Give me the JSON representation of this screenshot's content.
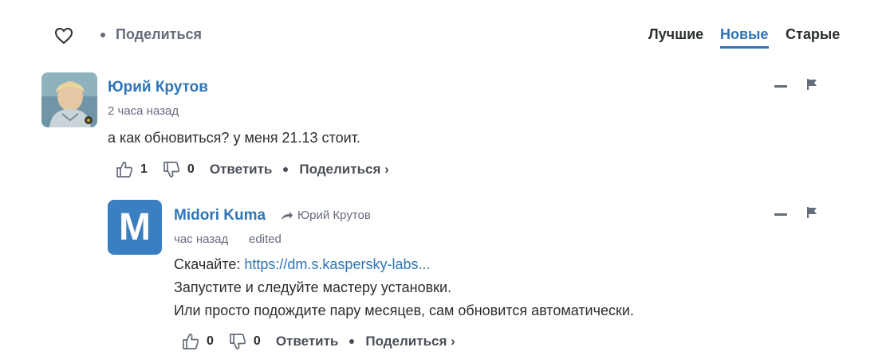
{
  "topbar": {
    "heart_icon": "heart-outline-icon",
    "share_label": "Поделиться",
    "sort": {
      "best": "Лучшие",
      "new": "Новые",
      "old": "Старые",
      "active": "new"
    }
  },
  "comments": [
    {
      "author": "Юрий Крутов",
      "time": "2 часа назад",
      "text": "а как обновиться? у меня 21.13 стоит.",
      "likes": "1",
      "dislikes": "0",
      "reply_label": "Ответить",
      "share_label": "Поделиться ›",
      "avatar_icon": "user-photo"
    },
    {
      "author": "Midori Kuma",
      "avatar_letter": "M",
      "reply_to": "Юрий Крутов",
      "time": "час назад",
      "edited": "edited",
      "text_prefix": "Скачайте: ",
      "link_text": "https://dm.s.kaspersky-labs...",
      "text_line2": "Запустите и следуйте мастеру установки.",
      "text_line3": "Или просто подождите пару месяцев, сам обновится автоматически.",
      "likes": "0",
      "dislikes": "0",
      "reply_label": "Ответить",
      "share_label": "Поделиться ›"
    }
  ],
  "colors": {
    "accent": "#2e75b6",
    "muted": "#656c7a",
    "text": "#2a2e2e",
    "avatar_bg": "#3a7fbf"
  }
}
